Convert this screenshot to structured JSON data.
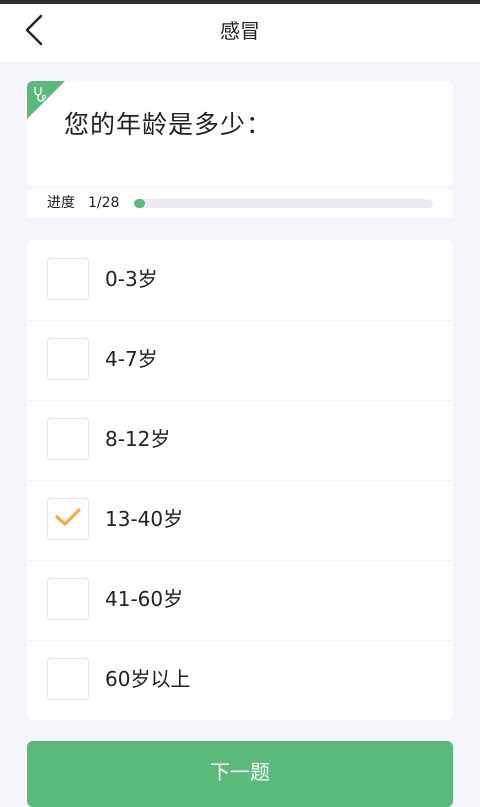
{
  "header": {
    "title": "感冒",
    "back_icon": "chevron-left-icon"
  },
  "question": {
    "text": "您的年龄是多少：",
    "tag_icon": "stethoscope-icon",
    "tag_color": "#5bb97b"
  },
  "progress": {
    "label": "进度",
    "value_text": "1/28",
    "fraction": 0.0357
  },
  "options": [
    {
      "label": "0-3岁",
      "checked": false
    },
    {
      "label": "4-7岁",
      "checked": false
    },
    {
      "label": "8-12岁",
      "checked": false
    },
    {
      "label": "13-40岁",
      "checked": true
    },
    {
      "label": "41-60岁",
      "checked": false
    },
    {
      "label": "60岁以上",
      "checked": false
    }
  ],
  "checkmark_color": "#f2ad4e",
  "next_button": {
    "label": "下一题",
    "color": "#5bb97b"
  }
}
